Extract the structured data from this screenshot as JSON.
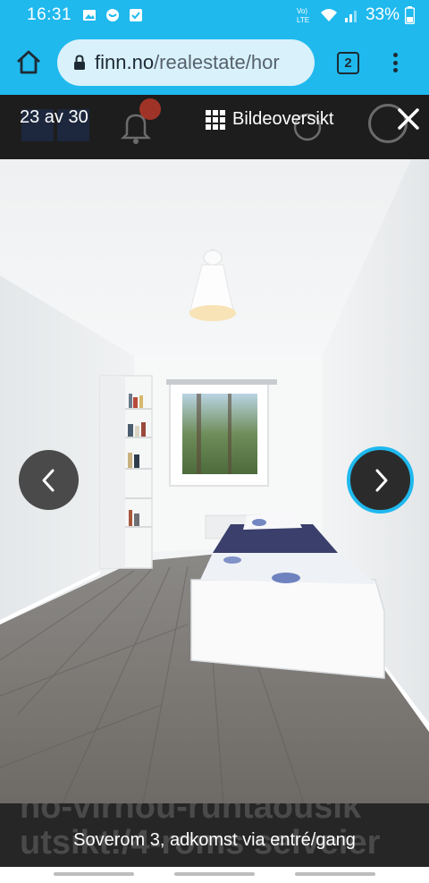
{
  "status_bar": {
    "time": "16:31",
    "battery": "33%",
    "network_label": "Vo) LTE"
  },
  "browser": {
    "url_domain": "finn.no",
    "url_path": "/realestate/hor",
    "tab_count": "2"
  },
  "gallery": {
    "counter": "23 av 30",
    "overview_label": "Bildeoversikt",
    "caption": "Soverom 3, adkomst via entré/gang",
    "underlying_heading": "utsikt!/4-roms selveier",
    "underlying_heading_partial": "no-virnou-runtaousik"
  },
  "colors": {
    "accent": "#1fb9ee",
    "gallery_bg": "#1d1d1d"
  },
  "icons": {
    "home": "home-icon",
    "lock": "lock-icon",
    "tabs": "tabs-icon",
    "menu": "more-vert-icon",
    "grid": "grid-icon",
    "close": "close-icon",
    "prev": "chevron-left-icon",
    "next": "chevron-right-icon"
  }
}
